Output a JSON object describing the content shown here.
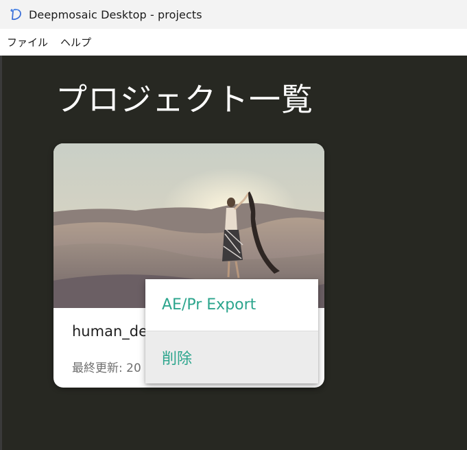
{
  "window": {
    "title": "Deepmosaic Desktop - projects",
    "icon": "deepmosaic-logo-icon"
  },
  "menubar": {
    "items": [
      {
        "label": "ファイル"
      },
      {
        "label": "ヘルプ"
      }
    ]
  },
  "page": {
    "title": "プロジェクト一覧"
  },
  "project_card": {
    "name": "human_de",
    "last_updated": "最終更新: 20",
    "image": "desert-woman-photo"
  },
  "context_menu": {
    "items": [
      {
        "label": "AE/Pr Export"
      },
      {
        "label": "削除"
      }
    ]
  },
  "colors": {
    "background": "#272822",
    "accent": "#2ca58d",
    "titlebar": "#f3f3f3"
  }
}
